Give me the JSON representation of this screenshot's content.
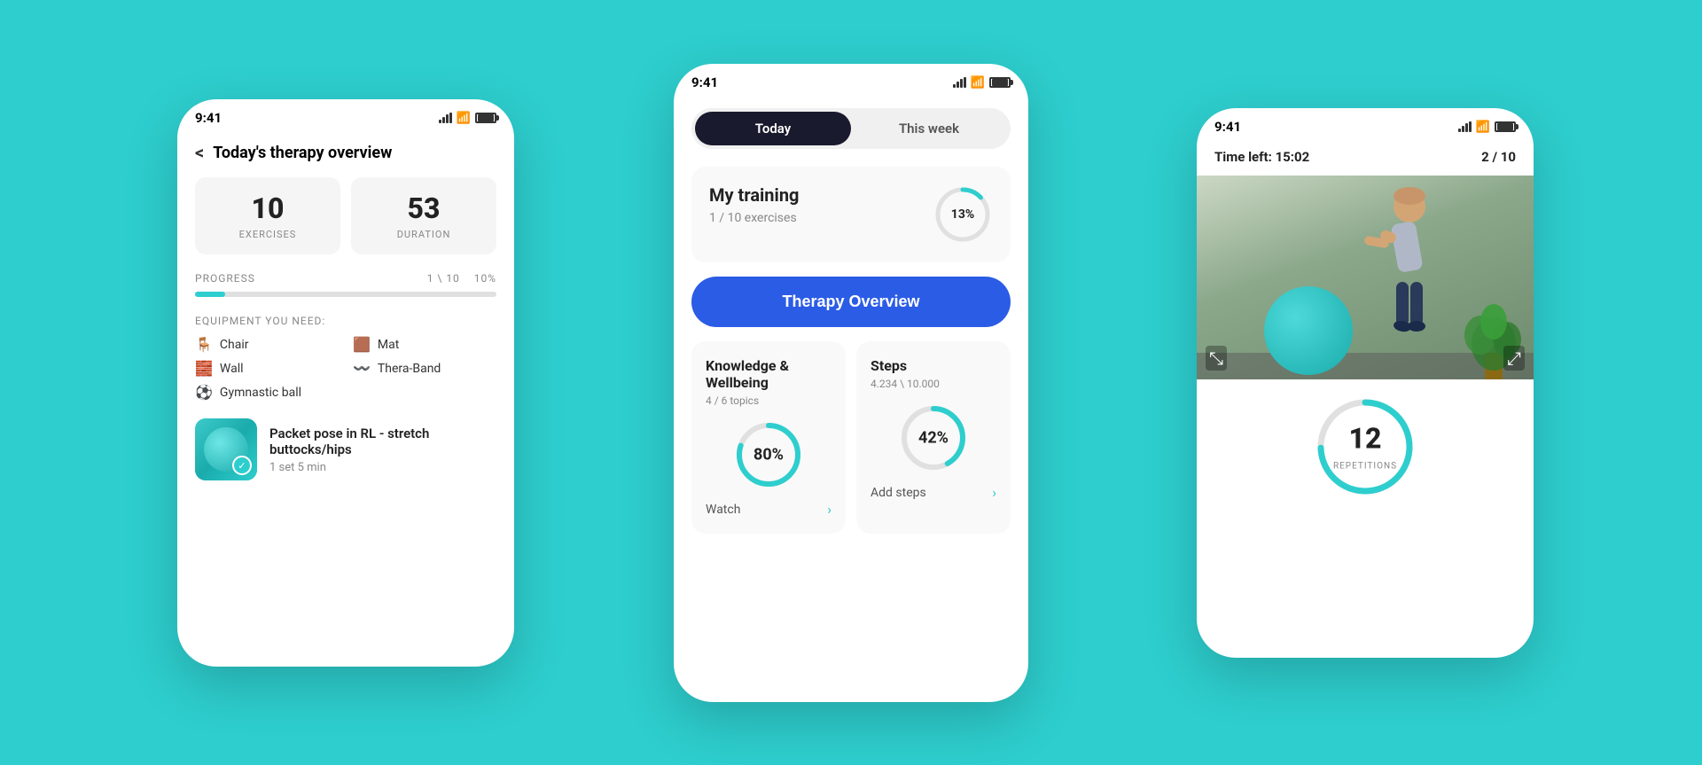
{
  "background_color": "#2ecece",
  "left_phone": {
    "status_time": "9:41",
    "header_back": "<",
    "header_title": "Today's therapy overview",
    "stat1_number": "10",
    "stat1_label": "EXERCISES",
    "stat2_number": "53",
    "stat2_label": "DURATION",
    "progress_label": "PROGRESS",
    "progress_value": "1 \\ 10",
    "progress_percent": "10%",
    "equipment_label": "EQUIPMENT YOU NEED:",
    "equipment": [
      "Chair",
      "Mat",
      "Wall",
      "Thera-Band",
      "Gymnastic ball"
    ],
    "exercise_name": "Packet pose in RL - stretch buttocks/hips",
    "exercise_meta": "1 set  5 min"
  },
  "center_phone": {
    "status_time": "9:41",
    "tab_today": "Today",
    "tab_this_week": "This week",
    "training_title": "My training",
    "training_sub": "1 / 10 exercises",
    "training_percent": "13%",
    "therapy_btn_label": "Therapy Overview",
    "knowledge_title": "Knowledge & Wellbeing",
    "knowledge_sub": "4 / 6 topics",
    "knowledge_percent": "80%",
    "knowledge_action": "Watch",
    "steps_title": "Steps",
    "steps_sub": "4.234 \\ 10.000",
    "steps_percent": "42%",
    "steps_action": "Add steps"
  },
  "right_phone": {
    "status_time": "9:41",
    "time_left_label": "Time left:",
    "time_left_value": "15:02",
    "exercise_count": "2 / 10",
    "rep_number": "12",
    "rep_label": "REPETITIONS"
  }
}
